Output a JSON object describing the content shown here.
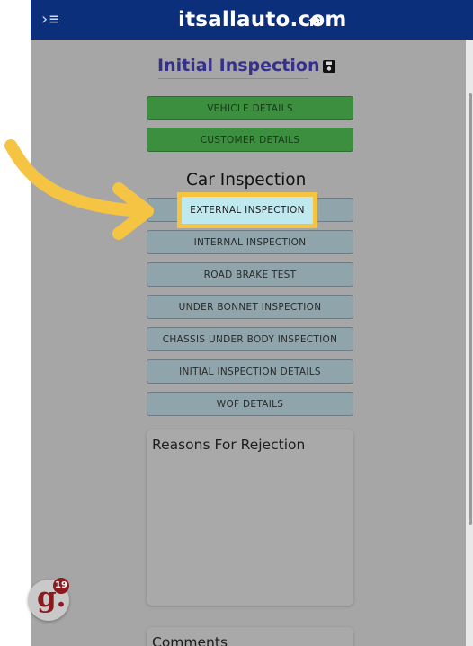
{
  "topbar": {
    "menu_icon": "menu-collapse-icon",
    "site_title": "itsallauto.com",
    "home_icon": "home-icon"
  },
  "page": {
    "title": "Initial Inspection",
    "save_icon": "save-icon"
  },
  "buttons_top": [
    {
      "label": "VEHICLE DETAILS",
      "state": "complete"
    },
    {
      "label": "CUSTOMER DETAILS",
      "state": "complete"
    }
  ],
  "car_inspection": {
    "title": "Car Inspection",
    "buttons": [
      {
        "label": "EXTERNAL INSPECTION",
        "highlighted": true
      },
      {
        "label": "INTERNAL INSPECTION"
      },
      {
        "label": "ROAD BRAKE TEST"
      },
      {
        "label": "UNDER BONNET INSPECTION"
      },
      {
        "label": "CHASSIS UNDER BODY INSPECTION"
      },
      {
        "label": "INITIAL INSPECTION DETAILS"
      },
      {
        "label": "WOF DETAILS"
      }
    ]
  },
  "cards": {
    "reasons_title": "Reasons For Rejection",
    "comments_title": "Comments"
  },
  "badge": {
    "letter": "g.",
    "count": "19"
  },
  "colors": {
    "topbar": "#0b2f7a",
    "title": "#35318a",
    "complete_button": "#3c8f3f",
    "highlight": "#f6c443",
    "arrow": "#f6c443"
  }
}
